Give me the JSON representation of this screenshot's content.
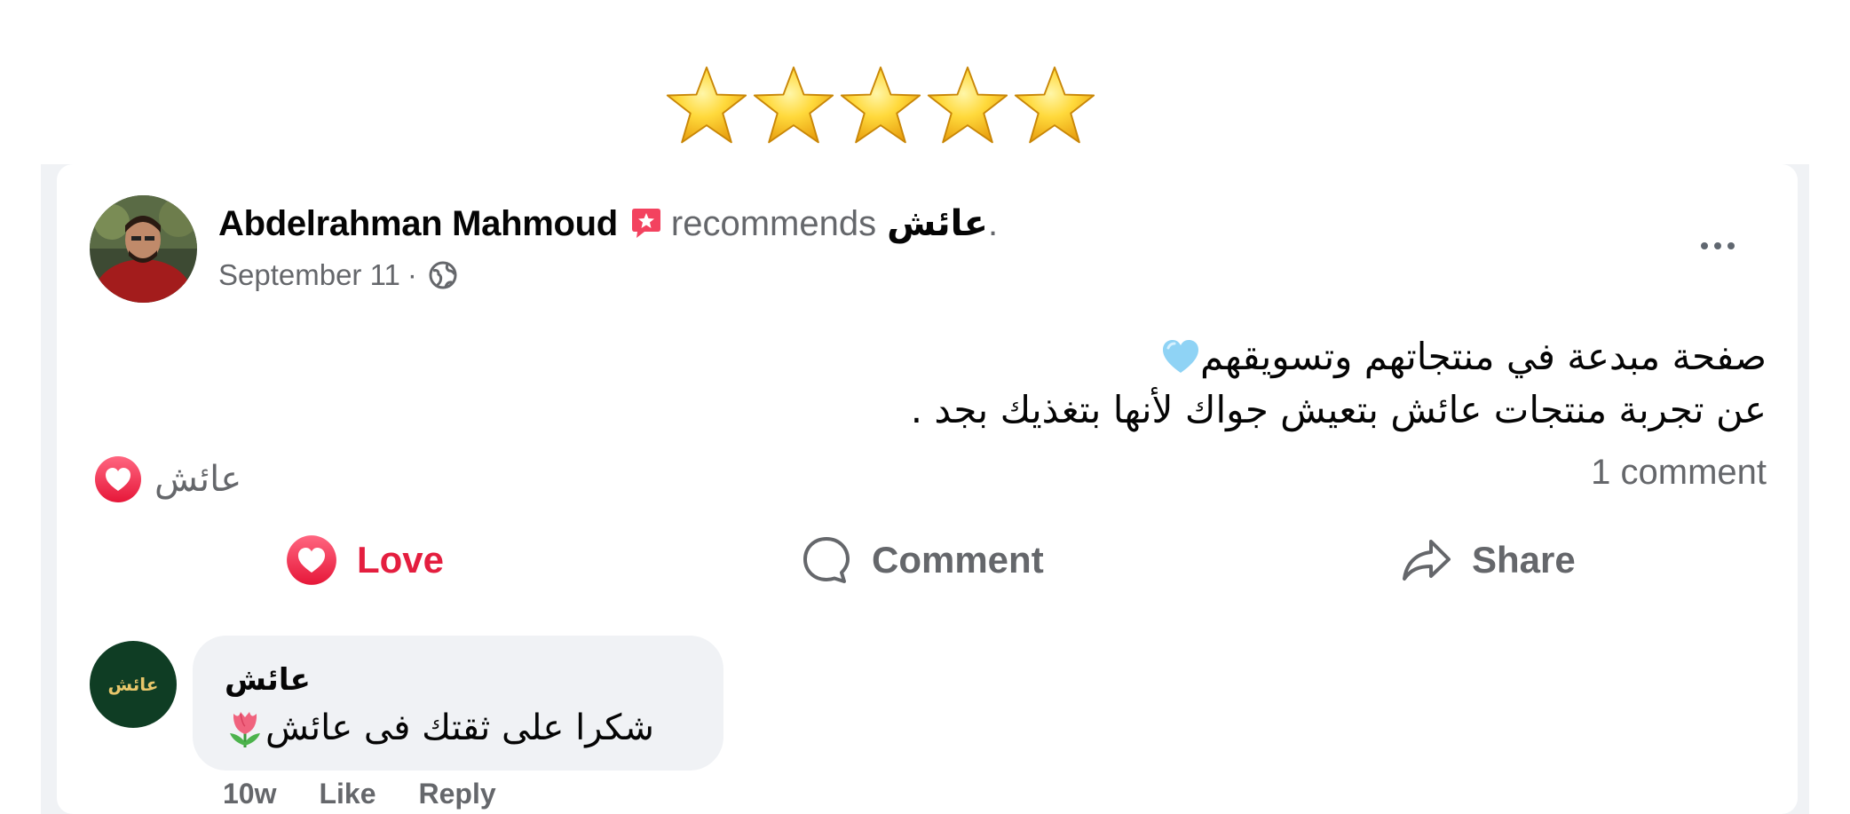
{
  "rating": {
    "stars": 5,
    "max": 5
  },
  "post": {
    "author": "Abdelrahman Mahmoud",
    "recommends_text": "recommends",
    "page_name": "عائش",
    "period": ".",
    "date": "September 11",
    "separator": "·",
    "text_line_1": "صفحة مبدعة في منتجاتهم وتسويقهم",
    "text_line_2": "عن تجربة منتجات عائش بتعيش جواك لأنها بتغذيك بجد .",
    "reaction_by": "عائش",
    "comment_count": "1 comment"
  },
  "actions": {
    "love": "Love",
    "comment": "Comment",
    "share": "Share"
  },
  "comment": {
    "avatar_text": "عائش",
    "author": "عائش",
    "text": "شكرا على ثقتك فى عائش",
    "time": "10w",
    "like": "Like",
    "reply": "Reply"
  },
  "colors": {
    "love_red": "#e41e3f",
    "secondary_text": "#65676b",
    "bubble_bg": "#f0f2f5",
    "star_gold": "#f7c32e"
  }
}
